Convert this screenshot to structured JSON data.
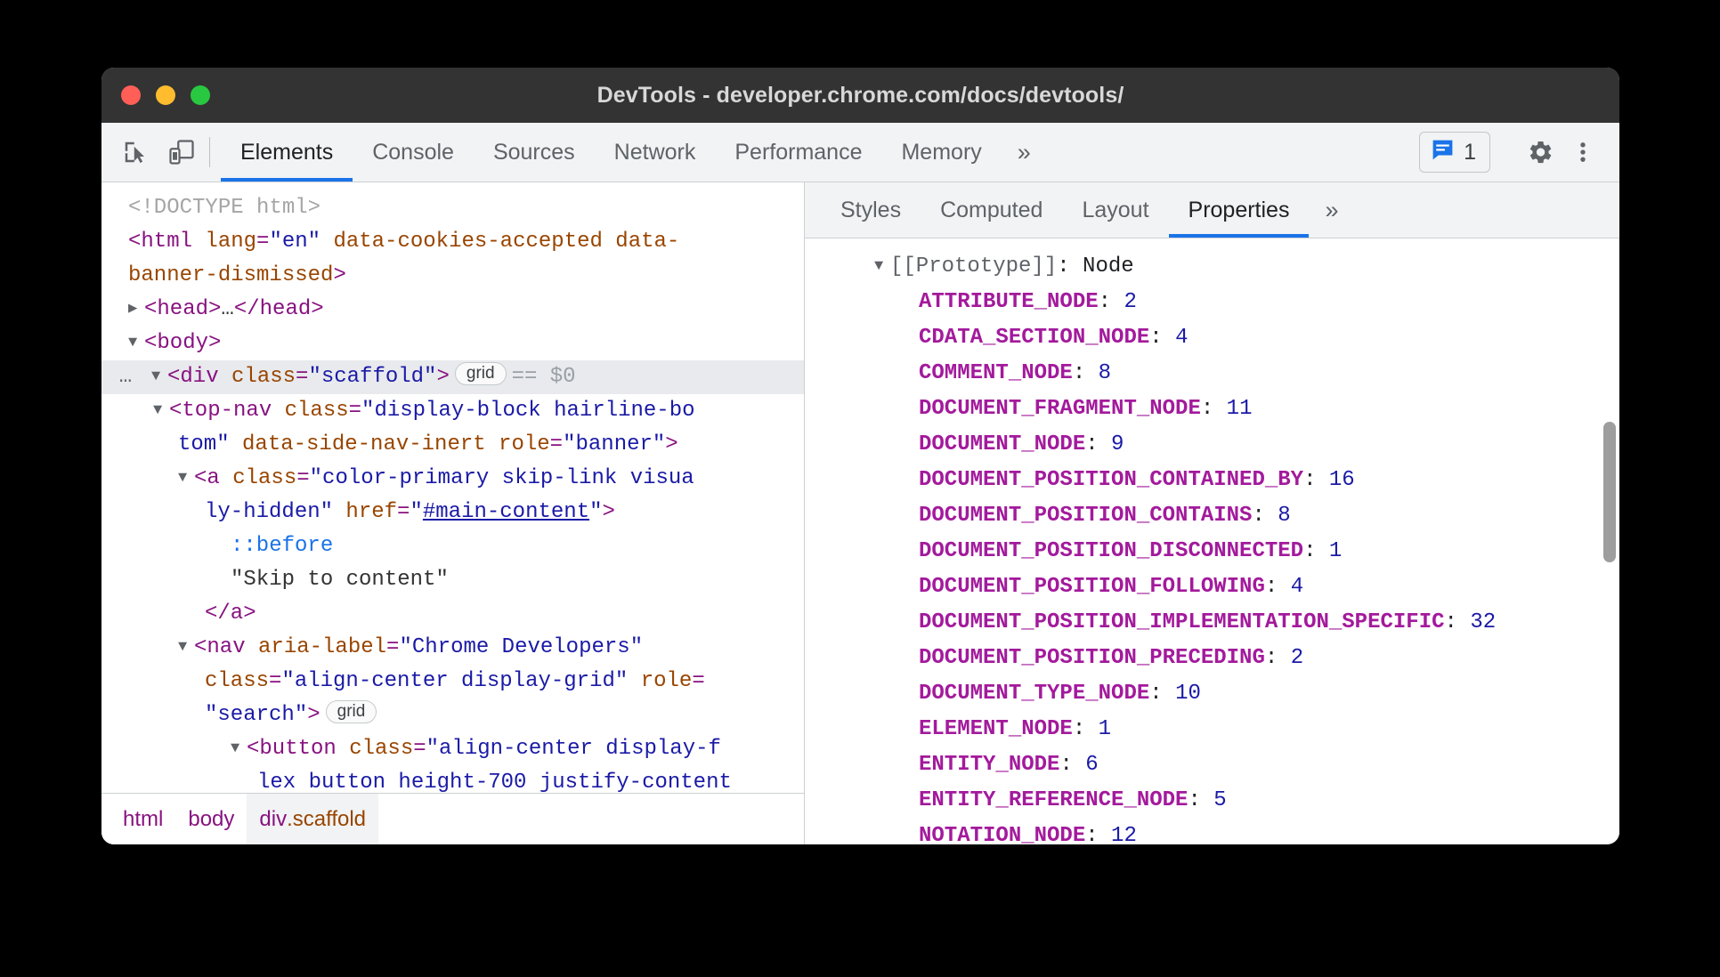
{
  "window": {
    "title": "DevTools - developer.chrome.com/docs/devtools/",
    "traffic_lights": [
      "close",
      "minimize",
      "maximize"
    ]
  },
  "toolbar": {
    "icons": [
      {
        "name": "inspect-element-icon",
        "label": "Inspect element"
      },
      {
        "name": "device-toolbar-icon",
        "label": "Toggle device toolbar"
      }
    ],
    "tabs": [
      {
        "label": "Elements",
        "active": true
      },
      {
        "label": "Console",
        "active": false
      },
      {
        "label": "Sources",
        "active": false
      },
      {
        "label": "Network",
        "active": false
      },
      {
        "label": "Performance",
        "active": false
      },
      {
        "label": "Memory",
        "active": false
      }
    ],
    "more_tabs": "»",
    "message_count": "1",
    "settings_label": "Settings",
    "more_options_label": "Customize and control DevTools",
    "accent_color": "#1a73e8"
  },
  "dom_tree": {
    "lines": [
      {
        "id": "doctype",
        "text": "<!DOCTYPE html>"
      },
      {
        "id": "html_open_1",
        "text": "<html lang=\"en\" data-cookies-accepted data-"
      },
      {
        "id": "html_open_2",
        "text": "banner-dismissed>"
      },
      {
        "id": "head",
        "text": "<head>…</head>"
      },
      {
        "id": "body",
        "text": "<body>"
      },
      {
        "id": "scaffold",
        "text": "<div class=\"scaffold\">",
        "badge": "grid",
        "suffix": "== $0",
        "gutter": "…",
        "selected": true
      },
      {
        "id": "topnav_1",
        "text": "<top-nav class=\"display-block hairline-bo"
      },
      {
        "id": "topnav_2",
        "text": "tom\" data-side-nav-inert role=\"banner\">"
      },
      {
        "id": "anchor_1",
        "text": "<a class=\"color-primary skip-link visua"
      },
      {
        "id": "anchor_2",
        "text": "ly-hidden\" href=\"#main-content\">"
      },
      {
        "id": "before",
        "text": "::before"
      },
      {
        "id": "skiptext",
        "text": "\"Skip to content\""
      },
      {
        "id": "anchor_close",
        "text": "</a>"
      },
      {
        "id": "nav_1",
        "text": "<nav aria-label=\"Chrome Developers\""
      },
      {
        "id": "nav_2",
        "text": "class=\"align-center display-grid\" role="
      },
      {
        "id": "nav_3",
        "text": "\"search\">",
        "badge": "grid"
      },
      {
        "id": "button_1",
        "text": "<button class=\"align-center display-f"
      },
      {
        "id": "button_2",
        "text": "lex button height-700 justify-content"
      }
    ]
  },
  "breadcrumb": {
    "items": [
      {
        "tag": "html",
        "cls": "",
        "active": false
      },
      {
        "tag": "body",
        "cls": "",
        "active": false
      },
      {
        "tag": "div",
        "cls": ".scaffold",
        "active": true
      }
    ]
  },
  "properties_panel": {
    "tabs": [
      {
        "label": "Styles",
        "active": false
      },
      {
        "label": "Computed",
        "active": false
      },
      {
        "label": "Layout",
        "active": false
      },
      {
        "label": "Properties",
        "active": true
      }
    ],
    "more_tabs": "»",
    "root": {
      "label": "[[Prototype]]",
      "value": "Node",
      "expanded": true
    },
    "rows": [
      {
        "name": "ATTRIBUTE_NODE",
        "value": "2"
      },
      {
        "name": "CDATA_SECTION_NODE",
        "value": "4"
      },
      {
        "name": "COMMENT_NODE",
        "value": "8"
      },
      {
        "name": "DOCUMENT_FRAGMENT_NODE",
        "value": "11"
      },
      {
        "name": "DOCUMENT_NODE",
        "value": "9"
      },
      {
        "name": "DOCUMENT_POSITION_CONTAINED_BY",
        "value": "16"
      },
      {
        "name": "DOCUMENT_POSITION_CONTAINS",
        "value": "8"
      },
      {
        "name": "DOCUMENT_POSITION_DISCONNECTED",
        "value": "1"
      },
      {
        "name": "DOCUMENT_POSITION_FOLLOWING",
        "value": "4"
      },
      {
        "name": "DOCUMENT_POSITION_IMPLEMENTATION_SPECIFIC",
        "value": "32"
      },
      {
        "name": "DOCUMENT_POSITION_PRECEDING",
        "value": "2"
      },
      {
        "name": "DOCUMENT_TYPE_NODE",
        "value": "10"
      },
      {
        "name": "ELEMENT_NODE",
        "value": "1"
      },
      {
        "name": "ENTITY_NODE",
        "value": "6"
      },
      {
        "name": "ENTITY_REFERENCE_NODE",
        "value": "5"
      },
      {
        "name": "NOTATION_NODE",
        "value": "12"
      }
    ]
  }
}
